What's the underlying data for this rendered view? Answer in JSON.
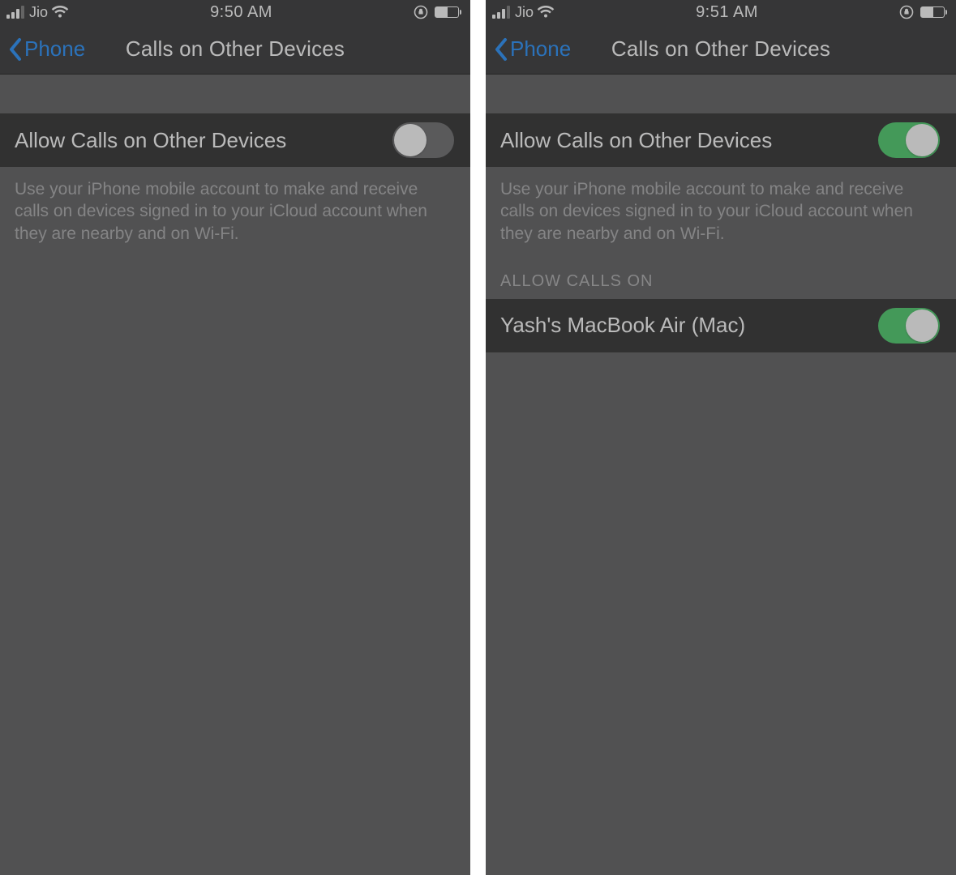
{
  "screens": [
    {
      "status": {
        "carrier": "Jio",
        "time": "9:50 AM"
      },
      "nav": {
        "back_label": "Phone",
        "title": "Calls on Other Devices"
      },
      "main_row": {
        "label": "Allow Calls on Other Devices",
        "on": false
      },
      "footer": "Use your iPhone mobile account to make and receive calls on devices signed in to your iCloud account when they are nearby and on Wi-Fi.",
      "devices_header": null,
      "devices": []
    },
    {
      "status": {
        "carrier": "Jio",
        "time": "9:51 AM"
      },
      "nav": {
        "back_label": "Phone",
        "title": "Calls on Other Devices"
      },
      "main_row": {
        "label": "Allow Calls on Other Devices",
        "on": true
      },
      "footer": "Use your iPhone mobile account to make and receive calls on devices signed in to your iCloud account when they are nearby and on Wi-Fi.",
      "devices_header": "ALLOW CALLS ON",
      "devices": [
        {
          "label": "Yash's MacBook Air (Mac)",
          "on": true
        }
      ]
    }
  ]
}
